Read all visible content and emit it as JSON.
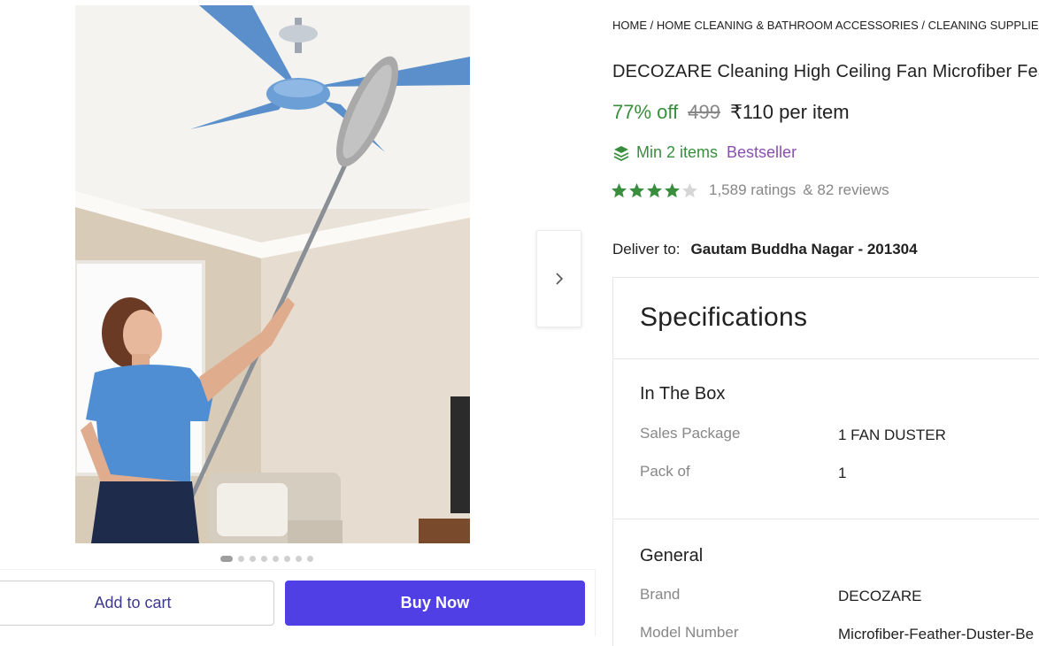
{
  "product": {
    "breadcrumb": "HOME / HOME CLEANING & BATHROOM ACCESSORIES / CLEANING SUPPLIES / D",
    "title": "DECOZARE Cleaning High Ceiling Fan Microfiber Feather Duster",
    "discount": "77% off",
    "mrp": "499",
    "price": "₹110 per item",
    "min_items": "Min 2 items",
    "bestseller": "Bestseller",
    "rating_value": 4,
    "rating_max": 5,
    "ratings_count": "1,589 ratings",
    "reviews_count": "& 82 reviews",
    "deliver_label": "Deliver to:",
    "deliver_location": "Gautam Buddha Nagar - 201304"
  },
  "gallery": {
    "image_count": 8,
    "active_index": 0
  },
  "actions": {
    "add_to_cart": "Add to cart",
    "buy_now": "Buy Now"
  },
  "specifications": {
    "title": "Specifications",
    "sections": [
      {
        "name": "In The Box",
        "rows": [
          {
            "label": "Sales Package",
            "value": "1 FAN DUSTER"
          },
          {
            "label": "Pack of",
            "value": "1"
          }
        ]
      },
      {
        "name": "General",
        "rows": [
          {
            "label": "Brand",
            "value": "DECOZARE"
          },
          {
            "label": "Model Number",
            "value": "Microfiber-Feather-Duster-Be"
          }
        ]
      }
    ]
  },
  "colors": {
    "discount_green": "#388e3c",
    "star_green": "#388e3c",
    "buy_button": "#4f3fe4",
    "bestseller_purple": "#8a4fb0",
    "cart_text": "#3d3b8e"
  },
  "icons": {
    "next": "chevron-right-icon",
    "min_items": "stack-layers-icon",
    "star": "star-icon"
  }
}
